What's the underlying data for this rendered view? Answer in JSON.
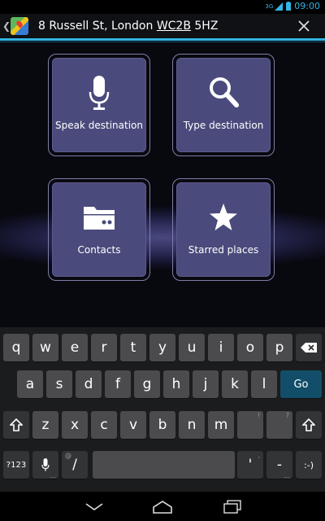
{
  "status_bar": {
    "network": "3G",
    "time": "09:00"
  },
  "action_bar": {
    "address_part1": "8 Russell St, London ",
    "address_underlined": "WC2B",
    "address_part2": " 5HZ"
  },
  "tiles": [
    {
      "label": "Speak destination",
      "icon": "microphone-icon"
    },
    {
      "label": "Type destination",
      "icon": "search-icon"
    },
    {
      "label": "Contacts",
      "icon": "contacts-icon"
    },
    {
      "label": "Starred places",
      "icon": "star-icon"
    }
  ],
  "keyboard": {
    "row1": [
      "q",
      "w",
      "e",
      "r",
      "t",
      "y",
      "u",
      "i",
      "o",
      "p"
    ],
    "row2": [
      "a",
      "s",
      "d",
      "f",
      "g",
      "h",
      "j",
      "k",
      "l"
    ],
    "row3": [
      "z",
      "x",
      "c",
      "v",
      "b",
      "n",
      "m"
    ],
    "go_label": "Go",
    "numbers_label": "?123",
    "slash": "/",
    "slash_hint": "@",
    "exclaim_hint": "!",
    "question_hint": "?",
    "comma_hint": ",",
    "apostrophe": "'",
    "dash": "-",
    "smiley": ":-)",
    "punct_hint_1": "...",
    "punct_hint_2": "…"
  }
}
